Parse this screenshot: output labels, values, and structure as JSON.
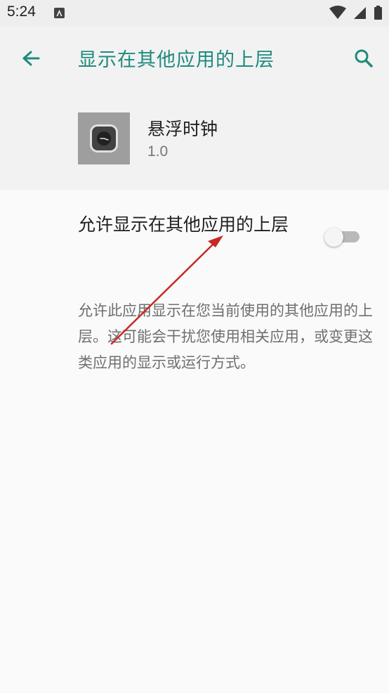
{
  "status_bar": {
    "time": "5:24",
    "icons": [
      "app-notification-icon",
      "wifi-icon",
      "signal-icon",
      "battery-icon"
    ]
  },
  "header": {
    "title": "显示在其他应用的上层",
    "back_icon": "arrow-left-icon",
    "search_icon": "search-icon"
  },
  "app": {
    "name": "悬浮时钟",
    "version": "1.0",
    "icon": "clock-icon"
  },
  "permission": {
    "label": "允许显示在其他应用的上层",
    "enabled": false
  },
  "description": "允许此应用显示在您当前使用的其他应用的上层。这可能会干扰您使用相关应用，或变更这类应用的显示或运行方式。",
  "colors": {
    "accent": "#1f8a7e",
    "annotation_arrow": "#c62828"
  }
}
